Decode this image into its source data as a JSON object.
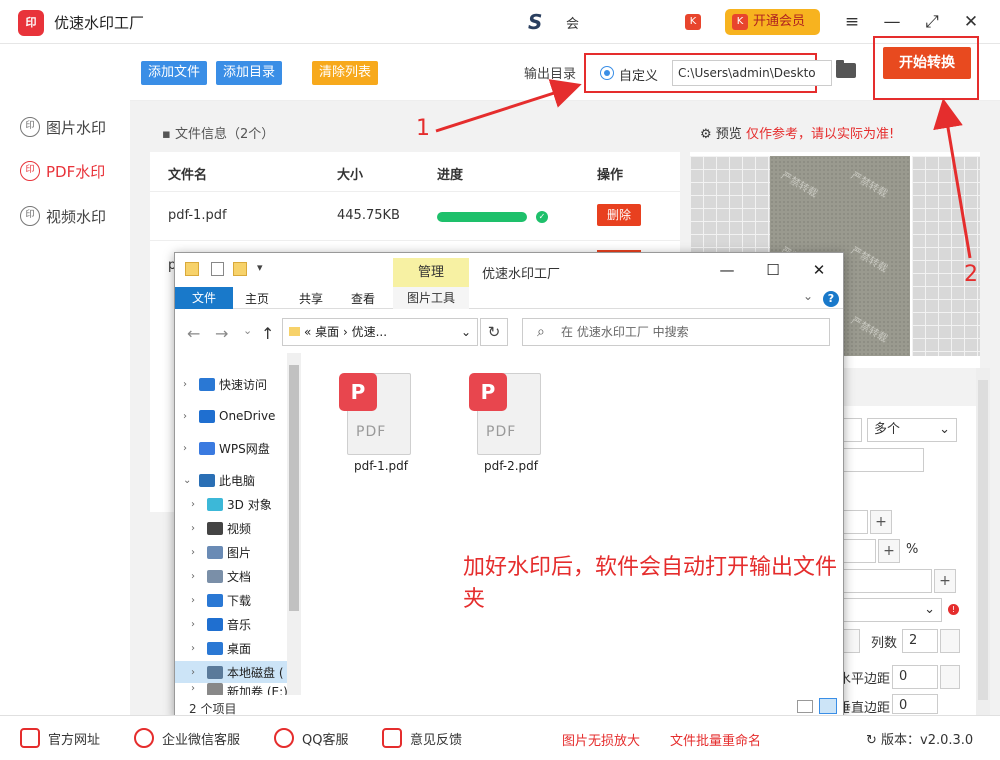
{
  "app": {
    "logo_text": "印",
    "title": "优速水印工厂"
  },
  "header": {
    "s_logo": "S",
    "user_text": "会",
    "vip_label": "开通会员",
    "vip_icon": "K",
    "small_icon": "K",
    "menu_icon": "≡",
    "minimize": "—",
    "maximize": "⤢",
    "close": "✕"
  },
  "sidebar": {
    "items": [
      {
        "label": "图片水印",
        "icon": "印"
      },
      {
        "label": "PDF水印",
        "icon": "印",
        "active": true
      },
      {
        "label": "视频水印",
        "icon": "印"
      }
    ]
  },
  "toolbar": {
    "add_file": "添加文件",
    "add_dir": "添加目录",
    "clear_list": "清除列表",
    "output_label": "输出目录",
    "custom_label": "自定义",
    "path_value": "C:\\Users\\admin\\Deskto",
    "start_label": "开始转换"
  },
  "file_panel": {
    "header": "文件信息（2个）",
    "columns": [
      "文件名",
      "大小",
      "进度",
      "操作"
    ],
    "rows": [
      {
        "name": "pdf-1.pdf",
        "size": "445.75KB",
        "progress": 1.0,
        "action": "删除"
      },
      {
        "name": "p",
        "size": "",
        "progress": 1.0,
        "action": ""
      }
    ]
  },
  "preview": {
    "label": "预览",
    "warning": "仅作参考，请以实际为准!",
    "watermark_text": "严禁转载"
  },
  "settings": {
    "multi_value": "多个",
    "percent": "%",
    "columns_label": "列数",
    "columns_value": "2",
    "hmargin_label": "水平边距",
    "hmargin_value": "0",
    "vmargin_label": "垂直边距",
    "vmargin_value": "0",
    "plus": "+",
    "minus": "-"
  },
  "explorer": {
    "manage": "管理",
    "app_name": "优速水印工厂",
    "tabs": {
      "file": "文件",
      "home": "主页",
      "share": "共享",
      "view": "查看",
      "picture_tools": "图片工具"
    },
    "address": "« 桌面 › 优速...",
    "search_placeholder": "在 优速水印工厂 中搜索",
    "tree": [
      {
        "label": "快速访问",
        "depth": 0,
        "color": "#2a78d4"
      },
      {
        "label": "OneDrive",
        "depth": 0,
        "color": "#1f6fd0"
      },
      {
        "label": "WPS网盘",
        "depth": 0,
        "color": "#3a7ae0"
      },
      {
        "label": "此电脑",
        "depth": 0,
        "color": "#2a6fb5",
        "expanded": true
      },
      {
        "label": "3D 对象",
        "depth": 1,
        "color": "#3cb8d8"
      },
      {
        "label": "视频",
        "depth": 1,
        "color": "#444"
      },
      {
        "label": "图片",
        "depth": 1,
        "color": "#6a8bb5"
      },
      {
        "label": "文档",
        "depth": 1,
        "color": "#7a8fa8"
      },
      {
        "label": "下载",
        "depth": 1,
        "color": "#2a78d4"
      },
      {
        "label": "音乐",
        "depth": 1,
        "color": "#1f6fd0"
      },
      {
        "label": "桌面",
        "depth": 1,
        "color": "#2a78d4"
      },
      {
        "label": "本地磁盘 (",
        "depth": 1,
        "color": "#5a7a9a",
        "selected": true
      },
      {
        "label": "新加卷 (E:)",
        "depth": 1,
        "color": "#888"
      }
    ],
    "files": [
      {
        "name": "pdf-1.pdf",
        "badge": "P",
        "type": "PDF"
      },
      {
        "name": "pdf-2.pdf",
        "badge": "P",
        "type": "PDF"
      }
    ],
    "annotation": "加好水印后，软件会自动打开输出文件夹",
    "status": "2 个项目"
  },
  "annotations": {
    "one": "1",
    "two": "2"
  },
  "bottom": {
    "items": [
      "官方网址",
      "企业微信客服",
      "QQ客服",
      "意见反馈"
    ],
    "links": [
      "图片无损放大",
      "文件批量重命名"
    ],
    "version": "版本：v2.0.3.0"
  }
}
